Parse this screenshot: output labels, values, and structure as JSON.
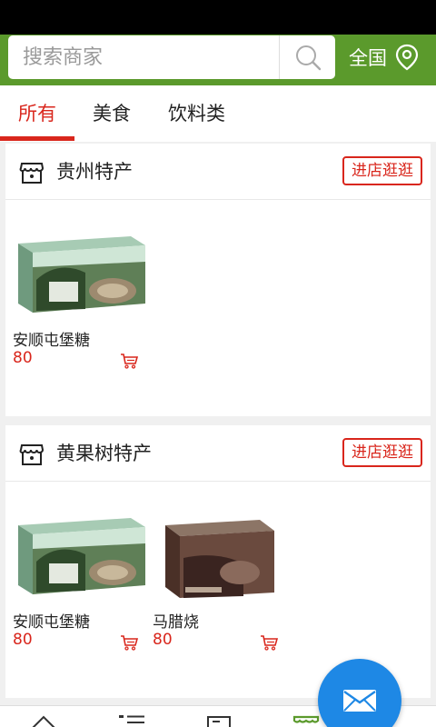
{
  "search": {
    "placeholder": "搜索商家"
  },
  "region": {
    "label": "全国"
  },
  "tabs": [
    {
      "label": "所有",
      "active": true
    },
    {
      "label": "美食",
      "active": false
    },
    {
      "label": "饮料类",
      "active": false
    }
  ],
  "shops": [
    {
      "name": "贵州特产",
      "visit_label": "进店逛逛",
      "products": [
        {
          "name": "安顺屯堡糖",
          "price": "80"
        }
      ]
    },
    {
      "name": "黄果树特产",
      "visit_label": "进店逛逛",
      "products": [
        {
          "name": "安顺屯堡糖",
          "price": "80"
        },
        {
          "name": "马腊烧",
          "price": "80"
        }
      ]
    }
  ],
  "colors": {
    "header_green": "#5b9a2c",
    "accent_red": "#d9261c",
    "fab_blue": "#1e88e5"
  },
  "icons": [
    "search-icon",
    "location-pin-icon",
    "shop-icon",
    "cart-icon",
    "mail-icon",
    "home-icon",
    "list-icon",
    "news-icon",
    "shop-nav-icon"
  ]
}
